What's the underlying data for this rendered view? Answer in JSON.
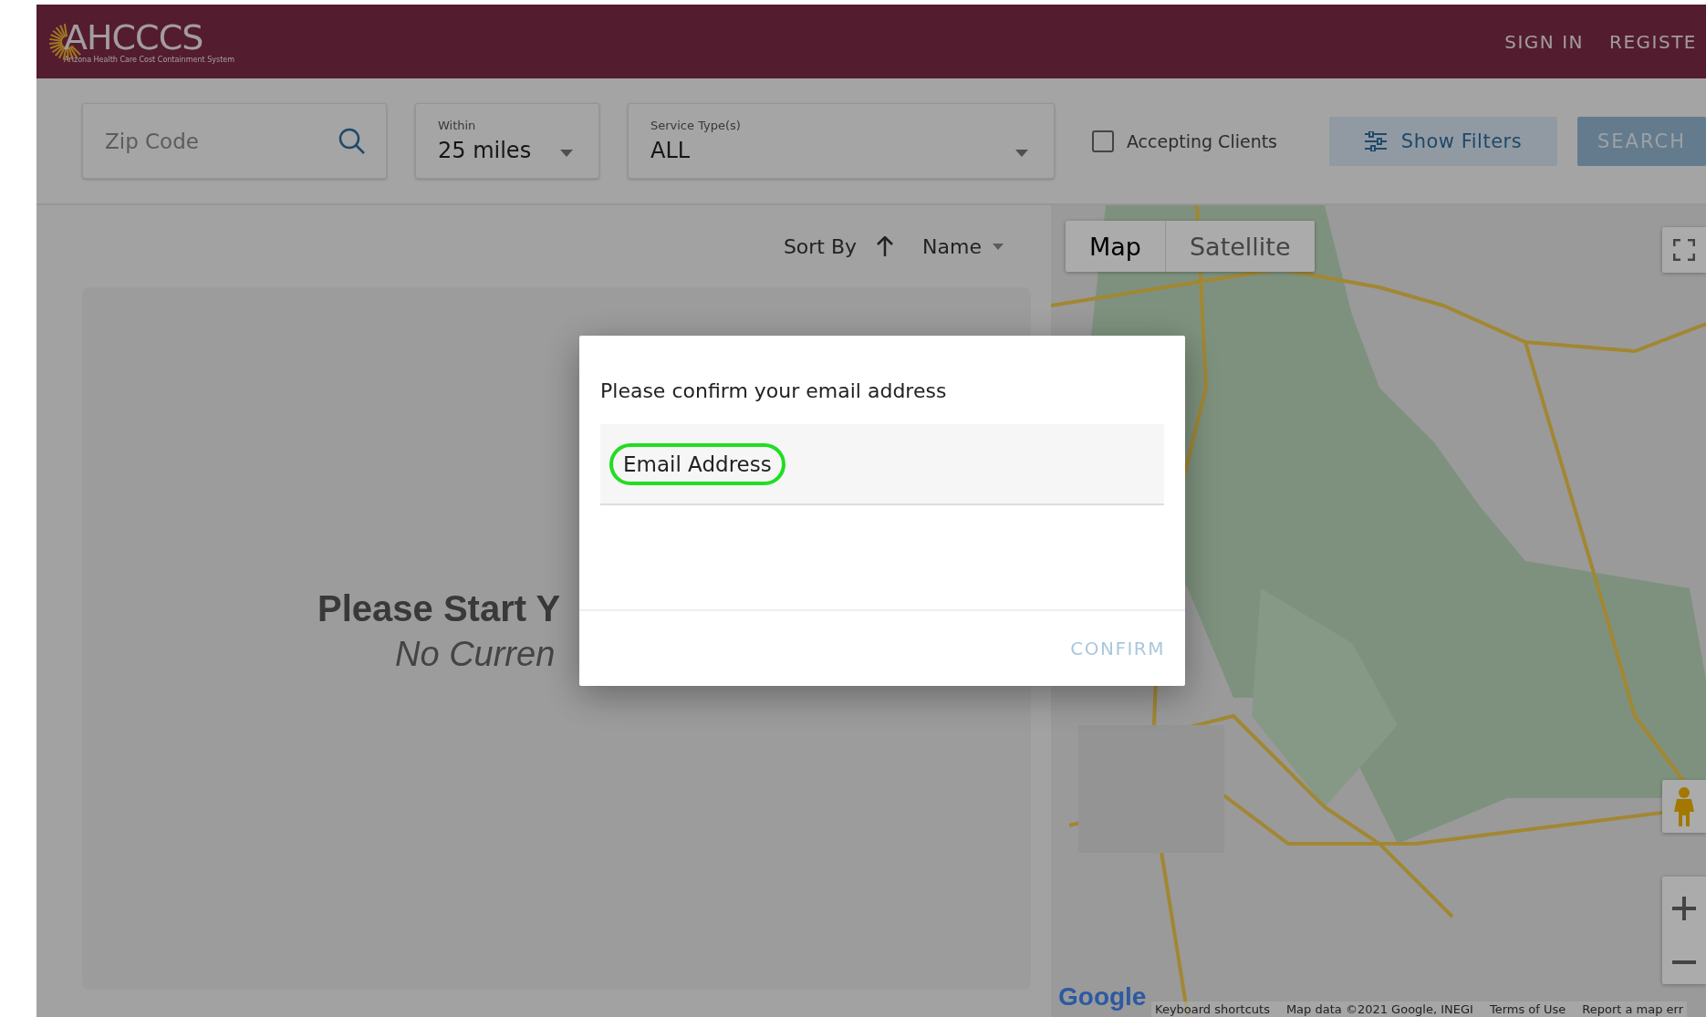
{
  "header": {
    "logo": "AHCCCS",
    "logo_tagline": "Arizona Health Care Cost Containment System",
    "nav": [
      "SIGN IN",
      "REGISTE"
    ]
  },
  "filters": {
    "zip": {
      "placeholder": "Zip Code"
    },
    "within": {
      "label": "Within",
      "value": "25 miles"
    },
    "service_types": {
      "label": "Service Type(s)",
      "value": "ALL"
    },
    "accepting_clients": {
      "label": "Accepting Clients",
      "checked": false
    },
    "buttons": [
      {
        "kind": "outline",
        "label": "Show Filters"
      },
      {
        "kind": "solid",
        "label": "SEARCH"
      }
    ]
  },
  "results": {
    "sort_label": "Sort By",
    "sort_field": "Name",
    "heading": "Please Start Y",
    "subheading": "No Curren"
  },
  "map": {
    "types": [
      {
        "label": "Map",
        "selected": true
      },
      {
        "label": "Satellite",
        "selected": false
      }
    ],
    "logo": "Google",
    "attribution": [
      "Keyboard shortcuts",
      "Map data ©2021 Google, INEGI",
      "Terms of Use",
      "Report a map err"
    ]
  },
  "dialog": {
    "title": "Please confirm your email address",
    "field": {
      "placeholder": "Email Address",
      "highlighted": true
    },
    "button": {
      "label": "CONFIRM",
      "disabled": true
    }
  }
}
